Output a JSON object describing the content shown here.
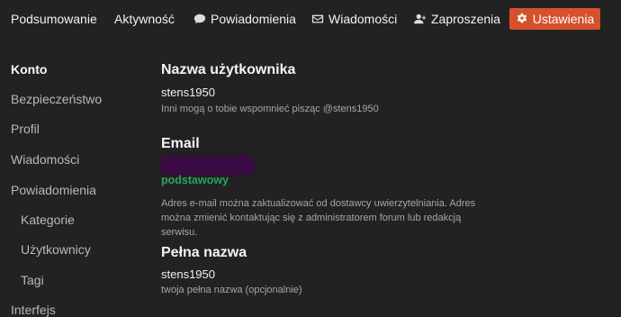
{
  "nav": {
    "summary": "Podsumowanie",
    "activity": "Aktywność",
    "notifications": "Powiadomienia",
    "messages": "Wiadomości",
    "invites": "Zaproszenia",
    "settings": "Ustawienia"
  },
  "sidebar": {
    "items": [
      {
        "label": "Konto"
      },
      {
        "label": "Bezpieczeństwo"
      },
      {
        "label": "Profil"
      },
      {
        "label": "Wiadomości"
      },
      {
        "label": "Powiadomienia"
      },
      {
        "label": "Kategorie"
      },
      {
        "label": "Użytkownicy"
      },
      {
        "label": "Tagi"
      },
      {
        "label": "Interfejs"
      }
    ]
  },
  "account": {
    "username_heading": "Nazwa użytkownika",
    "username_value": "stens1950",
    "username_help": "Inni mogą o tobie wspomnieć pisząc @stens1950",
    "email_heading": "Email",
    "email_badge": "podstawowy",
    "email_help": "Adres e-mail można zaktualizować od dostawcy uwierzytelniania. Adres można zmienić kontaktując się z administratorem forum lub redakcją serwisu.",
    "fullname_heading": "Pełna nazwa",
    "fullname_value": "stens1950",
    "fullname_help": "twoja pełna nazwa (opcjonalnie)"
  },
  "colors": {
    "background": "#222222",
    "accent": "#d4512c",
    "primary_badge": "#26a65b"
  }
}
